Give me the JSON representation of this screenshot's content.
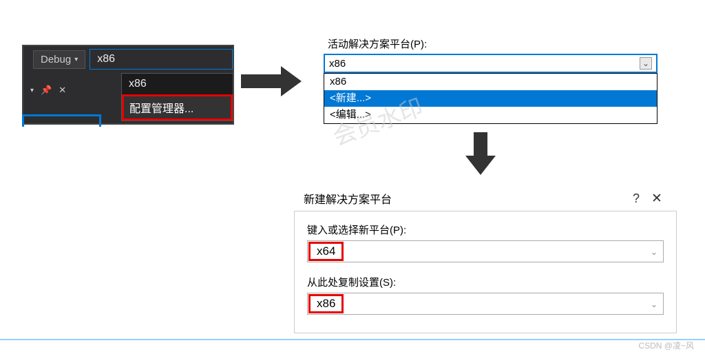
{
  "vs_toolbar": {
    "config_label": "Debug",
    "platform_selected": "x86",
    "dropdown": {
      "item_platform": "x86",
      "item_config_manager": "配置管理器..."
    }
  },
  "platform_panel": {
    "label": "活动解决方案平台(P):",
    "selected": "x86",
    "options": {
      "opt_x86": "x86",
      "opt_new": "<新建...>",
      "opt_edit": "<编辑...>"
    }
  },
  "dialog": {
    "title": "新建解决方案平台",
    "help_glyph": "?",
    "close_glyph": "✕",
    "field1_label": "键入或选择新平台(P):",
    "field1_value": "x64",
    "field2_label": "从此处复制设置(S):",
    "field2_value": "x86"
  },
  "watermark": "会员水印",
  "credit": "CSDN @凌~风"
}
